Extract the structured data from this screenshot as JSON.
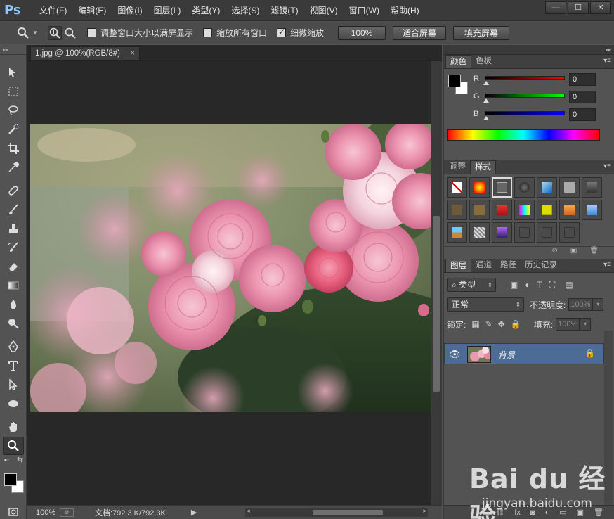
{
  "app": {
    "logo": "Ps"
  },
  "menu": [
    "文件(F)",
    "编辑(E)",
    "图像(I)",
    "图层(L)",
    "类型(Y)",
    "选择(S)",
    "滤镜(T)",
    "视图(V)",
    "窗口(W)",
    "帮助(H)"
  ],
  "window_buttons": [
    "—",
    "☐",
    "✕"
  ],
  "options": {
    "resize_windows_label": "调整窗口大小以满屏显示",
    "zoom_all_label": "缩放所有窗口",
    "scrubby_label": "细微缩放",
    "btn_100": "100%",
    "btn_fit": "适合屏幕",
    "btn_fill": "填充屏幕"
  },
  "document": {
    "tab_title": "1.jpg @ 100%(RGB/8#)",
    "tab_close": "×",
    "zoom": "100%",
    "doc_info": "文档:792.3 K/792.3K"
  },
  "color_panel": {
    "tabs": [
      "颜色",
      "色板"
    ],
    "channels": [
      {
        "label": "R",
        "value": "0"
      },
      {
        "label": "G",
        "value": "0"
      },
      {
        "label": "B",
        "value": "0"
      }
    ]
  },
  "styles_panel": {
    "tabs": [
      "调整",
      "样式"
    ]
  },
  "layers_panel": {
    "tabs": [
      "图层",
      "通道",
      "路径",
      "历史记录"
    ],
    "filter_label": "类型",
    "blend_mode": "正常",
    "opacity_label": "不透明度:",
    "opacity_value": "100%",
    "lock_label": "锁定:",
    "fill_label": "填充:",
    "fill_value": "100%",
    "layer_name": "背景"
  },
  "watermark": {
    "brand": "Bai du 经验",
    "url": "jingyan.baidu.com"
  },
  "colors": {
    "selected_layer": "#4c6b95",
    "panel_bg": "#535353",
    "canvas_bg": "#282828"
  }
}
